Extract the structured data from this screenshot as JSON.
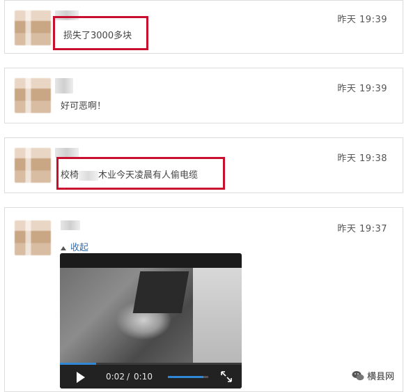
{
  "comments": [
    {
      "time": "昨天 19:39",
      "text": "损失了3000多块"
    },
    {
      "time": "昨天 19:39",
      "text": "好可恶啊！"
    },
    {
      "time": "昨天 19:38",
      "text_prefix": "校椅",
      "text_suffix": "木业今天凌晨有人偷电缆"
    },
    {
      "time": "昨天 19:37",
      "collapse_label": "收起"
    }
  ],
  "video": {
    "current_time": "0:02",
    "separator": "/",
    "duration": "0:10",
    "progress": 0.2,
    "volume": 0.88
  },
  "watermark": {
    "text": "横县网"
  },
  "colors": {
    "highlight_box": "#c8102e",
    "accent": "#2f87d6",
    "link": "#2e6fb6"
  },
  "icons": [
    "play-icon",
    "fullscreen-icon",
    "collapse-arrow-icon",
    "wechat-icon"
  ]
}
